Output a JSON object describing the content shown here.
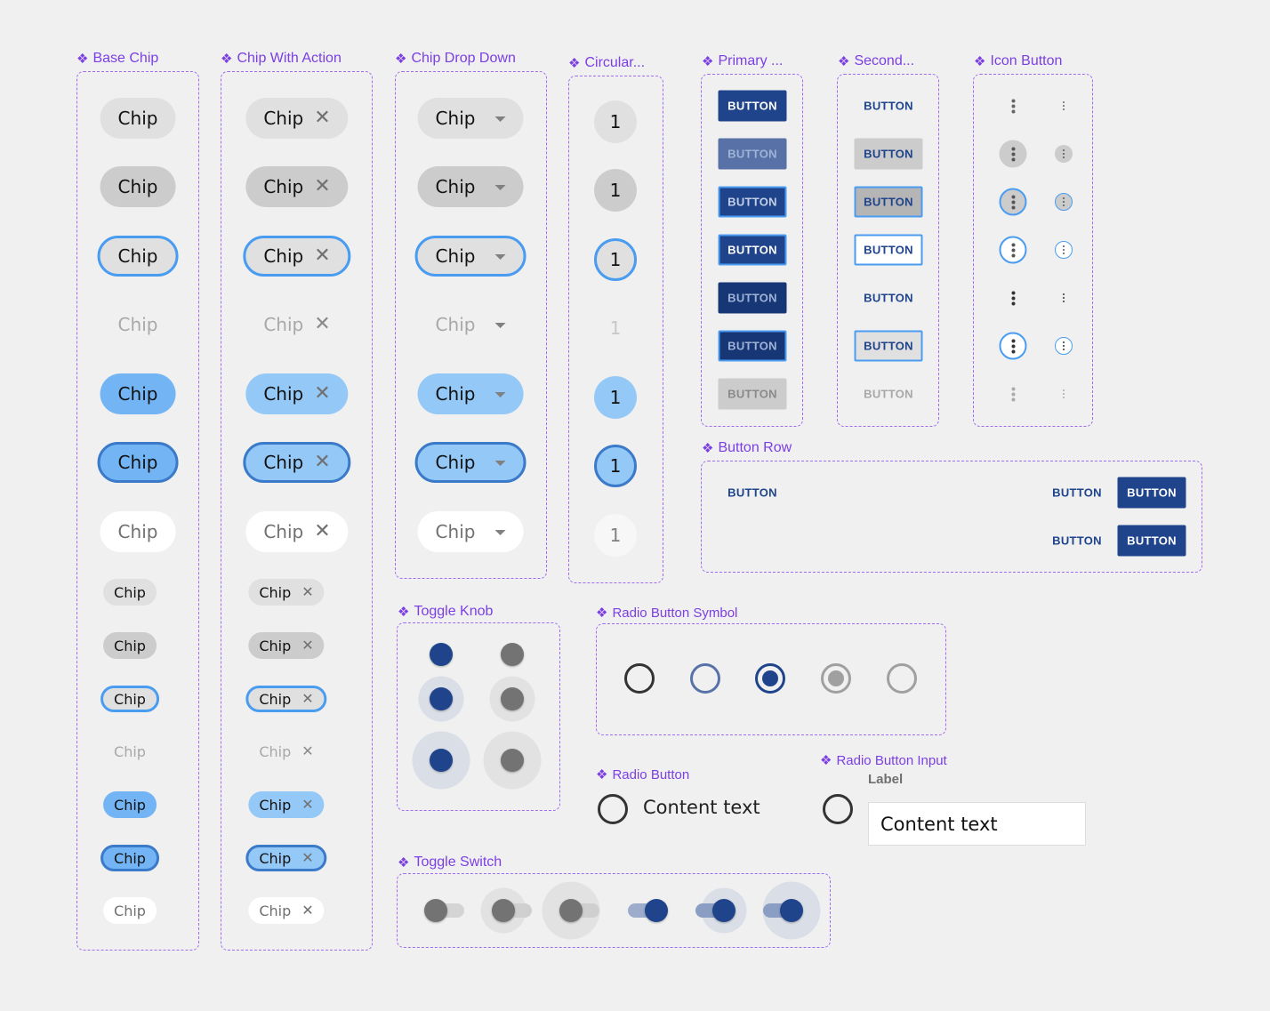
{
  "frames": {
    "base_chip": "Base Chip",
    "chip_with_action": "Chip With Action",
    "chip_drop_down": "Chip Drop Down",
    "circular": "Circular...",
    "primary": "Primary ...",
    "secondary": "Second...",
    "icon_button": "Icon Button",
    "button_row": "Button Row",
    "toggle_knob": "Toggle Knob",
    "radio_button_symbol": "Radio Button Symbol",
    "radio_button": "Radio Button",
    "radio_button_input": "Radio Button Input",
    "toggle_switch": "Toggle Switch"
  },
  "icons": {
    "frame_marker": "component-diamond-icon",
    "chip_action": "close-icon",
    "chip_dropdown": "caret-down-icon",
    "icon_button": "more-vertical-icon"
  },
  "glyphs": {
    "diamond": "❖",
    "close": "✕"
  },
  "chip": {
    "label": "Chip",
    "large_states": [
      "default",
      "hover",
      "focus",
      "disabled",
      "selected",
      "selected-focus",
      "white"
    ],
    "small_states": [
      "default",
      "hover",
      "focus",
      "disabled",
      "selected",
      "selected-focus",
      "white"
    ]
  },
  "circular": {
    "label": "1",
    "states": [
      "default",
      "hover",
      "focus",
      "disabled",
      "selected",
      "selected-focus",
      "white"
    ]
  },
  "primary_buttons": {
    "label": "BUTTON",
    "states": [
      "default",
      "hover",
      "focus",
      "focus-alt",
      "pressed",
      "pressed-focus",
      "disabled"
    ]
  },
  "secondary_buttons": {
    "label": "BUTTON",
    "states": [
      "default",
      "hover",
      "focus",
      "focus-alt",
      "pressed",
      "pressed-focus",
      "disabled"
    ]
  },
  "button_row": {
    "row1": {
      "left": "BUTTON",
      "secondary": "BUTTON",
      "primary": "BUTTON"
    },
    "row2": {
      "secondary": "BUTTON",
      "primary": "BUTTON"
    }
  },
  "toggle_knob": {
    "columns": [
      "on",
      "off"
    ],
    "rows": [
      "default",
      "hover",
      "pressed"
    ]
  },
  "radio_symbols": [
    "unchecked",
    "unchecked-hover",
    "checked",
    "checked-disabled",
    "unchecked-disabled"
  ],
  "radio_button": {
    "content": "Content text"
  },
  "radio_button_input": {
    "label": "Label",
    "value": "Content text"
  },
  "toggle_switch": {
    "states": [
      "off",
      "off-hover",
      "off-pressed",
      "on",
      "on-hover",
      "on-pressed"
    ]
  },
  "colors": {
    "frame": "#9d6cf0",
    "frame_title": "#7b3fe4",
    "primary": "#1f448c",
    "focus": "#4a9cf0",
    "selected": "#72b4f4",
    "chip_default": "#e0e0e0",
    "chip_hover": "#cccccc"
  }
}
